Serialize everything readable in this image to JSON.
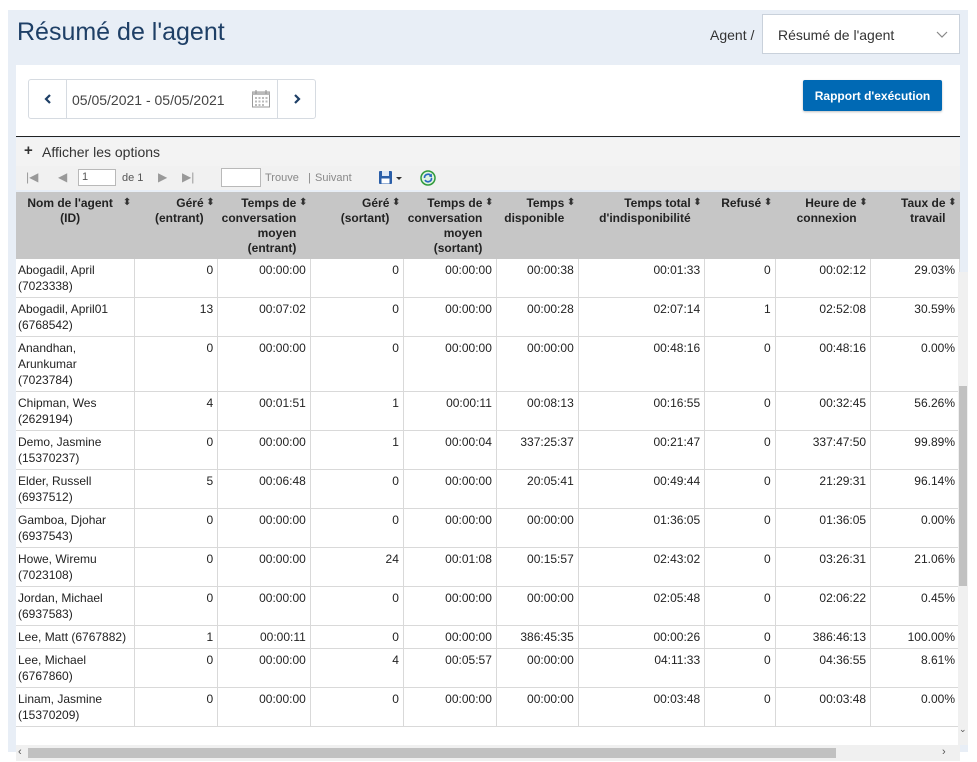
{
  "header": {
    "title": "Résumé de l'agent",
    "agent_label": "Agent /",
    "agent_select_value": "Résumé de l'agent"
  },
  "toolbar": {
    "date_range": "05/05/2021 - 05/05/2021",
    "run_report_label": "Rapport d'exécution",
    "prev_icon": "chevron-left-icon",
    "next_icon": "chevron-right-icon",
    "calendar_icon": "calendar-icon"
  },
  "options": {
    "toggle_label": "Afficher les options"
  },
  "pager": {
    "page_value": "1",
    "of_label": "de 1",
    "find_label": "Trouve",
    "separator": "|",
    "next_label": "Suivant"
  },
  "grid": {
    "columns": [
      "Nom de l'agent (ID)",
      "Géré (entrant)",
      "Temps de conversation moyen (entrant)",
      "Géré (sortant)",
      "Temps de conversation moyen (sortant)",
      "Temps disponible",
      "Temps total d'indisponibilité",
      "Refusé",
      "Heure de connexion",
      "Taux de travail"
    ],
    "rows": [
      [
        "Abogadil, April (7023338)",
        "0",
        "00:00:00",
        "0",
        "00:00:00",
        "00:00:38",
        "00:01:33",
        "0",
        "00:02:12",
        "29.03%"
      ],
      [
        "Abogadil, April01 (6768542)",
        "13",
        "00:07:02",
        "0",
        "00:00:00",
        "00:00:28",
        "02:07:14",
        "1",
        "02:52:08",
        "30.59%"
      ],
      [
        "Anandhan, Arunkumar (7023784)",
        "0",
        "00:00:00",
        "0",
        "00:00:00",
        "00:00:00",
        "00:48:16",
        "0",
        "00:48:16",
        "0.00%"
      ],
      [
        "Chipman, Wes (2629194)",
        "4",
        "00:01:51",
        "1",
        "00:00:11",
        "00:08:13",
        "00:16:55",
        "0",
        "00:32:45",
        "56.26%"
      ],
      [
        "Demo, Jasmine (15370237)",
        "0",
        "00:00:00",
        "1",
        "00:00:04",
        "337:25:37",
        "00:21:47",
        "0",
        "337:47:50",
        "99.89%"
      ],
      [
        "Elder, Russell (6937512)",
        "5",
        "00:06:48",
        "0",
        "00:00:00",
        "20:05:41",
        "00:49:44",
        "0",
        "21:29:31",
        "96.14%"
      ],
      [
        "Gamboa, Djohar (6937543)",
        "0",
        "00:00:00",
        "0",
        "00:00:00",
        "00:00:00",
        "01:36:05",
        "0",
        "01:36:05",
        "0.00%"
      ],
      [
        "Howe, Wiremu (7023108)",
        "0",
        "00:00:00",
        "24",
        "00:01:08",
        "00:15:57",
        "02:43:02",
        "0",
        "03:26:31",
        "21.06%"
      ],
      [
        "Jordan, Michael (6937583)",
        "0",
        "00:00:00",
        "0",
        "00:00:00",
        "00:00:00",
        "02:05:48",
        "0",
        "02:06:22",
        "0.45%"
      ],
      [
        "Lee, Matt (6767882)",
        "1",
        "00:00:11",
        "0",
        "00:00:00",
        "386:45:35",
        "00:00:26",
        "0",
        "386:46:13",
        "100.00%"
      ],
      [
        "Lee, Michael (6767860)",
        "0",
        "00:00:00",
        "4",
        "00:05:57",
        "00:00:00",
        "04:11:33",
        "0",
        "04:36:55",
        "8.61%"
      ],
      [
        "Linam, Jasmine (15370209)",
        "0",
        "00:00:00",
        "0",
        "00:00:00",
        "00:00:00",
        "00:03:48",
        "0",
        "00:03:48",
        "0.00%"
      ]
    ]
  }
}
